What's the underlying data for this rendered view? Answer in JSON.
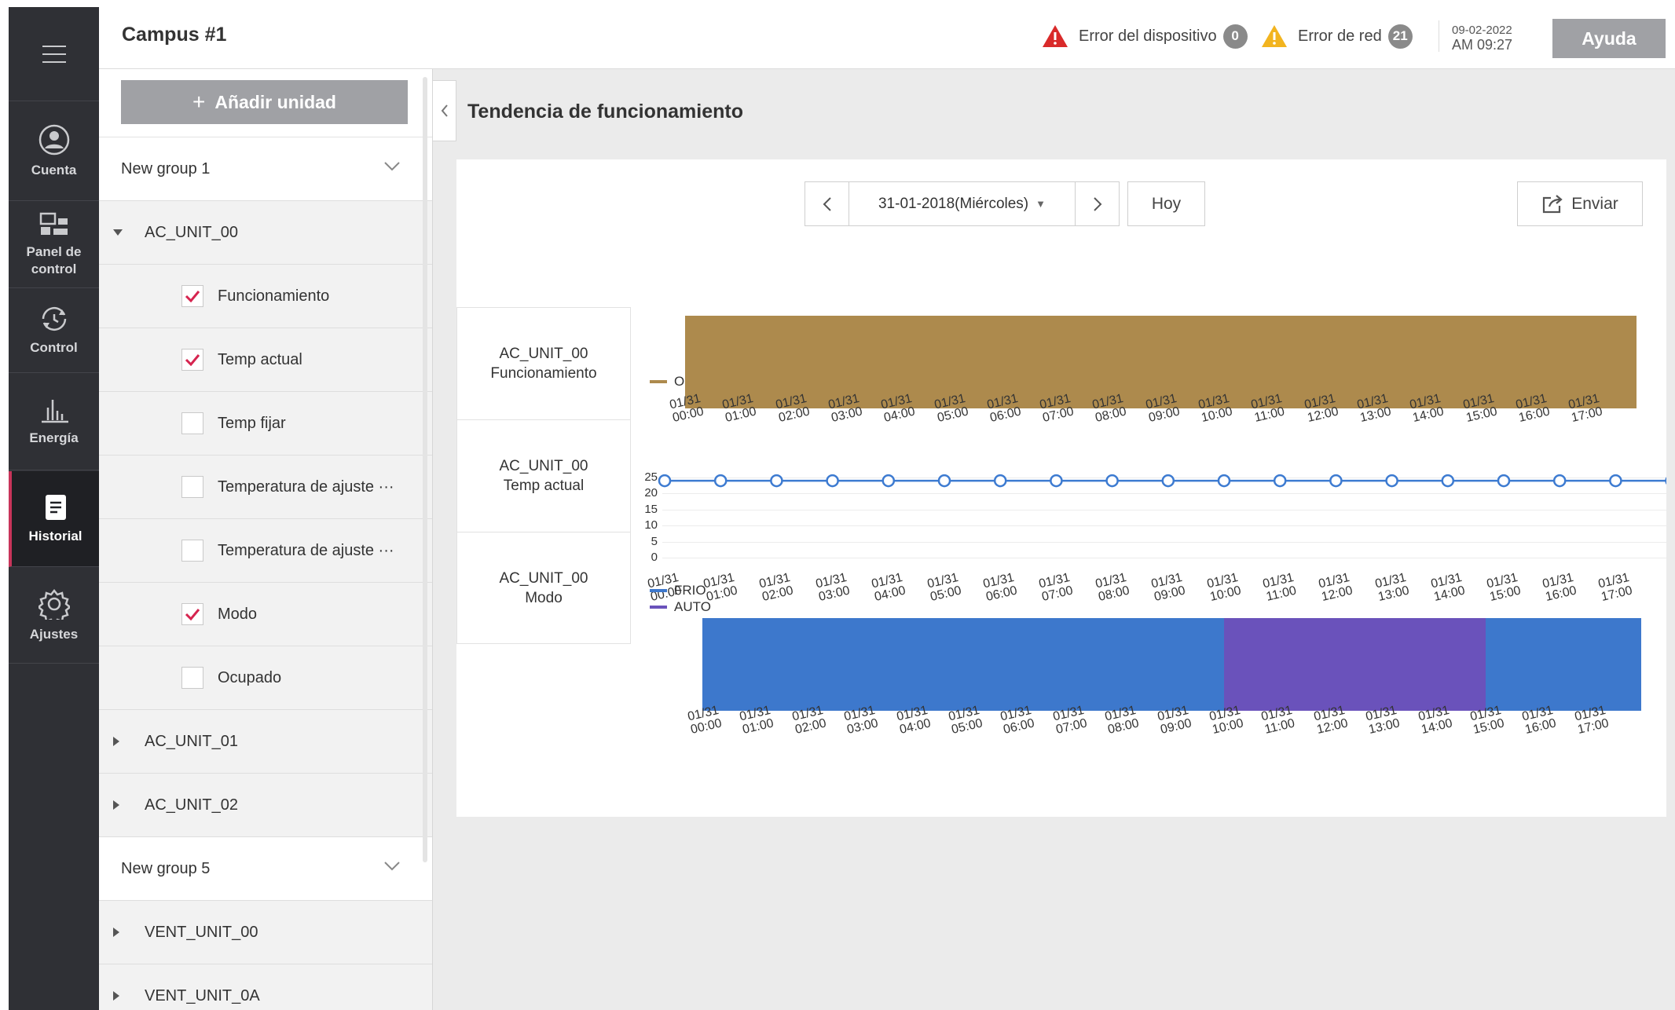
{
  "nav": {
    "menu_icon": "hamburger-icon",
    "items": [
      {
        "label": "Cuenta",
        "icon": "user-circle-icon"
      },
      {
        "label": "Panel de\ncontrol",
        "label_l1": "Panel de",
        "label_l2": "control",
        "icon": "dashboard-icon"
      },
      {
        "label": "Control",
        "icon": "control-icon"
      },
      {
        "label": "Energía",
        "icon": "bar-chart-icon"
      },
      {
        "label": "Historial",
        "icon": "history-icon",
        "active": true
      },
      {
        "label": "Ajustes",
        "icon": "gear-icon"
      }
    ]
  },
  "header": {
    "title": "Campus #1",
    "device_error_label": "Error del dispositivo",
    "device_error_count": "0",
    "network_error_label": "Error de red",
    "network_error_count": "21",
    "date": "09-02-2022",
    "time": "AM 09:27",
    "help_label": "Ayuda",
    "colors": {
      "device_error": "#d92a2a",
      "network_error": "#f2b41f"
    }
  },
  "sidebar": {
    "add_unit_label": "Añadir unidad",
    "groups": [
      {
        "name": "New group 1",
        "units": [
          {
            "name": "AC_UNIT_00",
            "expanded": true,
            "attributes": [
              {
                "label": "Funcionamiento",
                "checked": true
              },
              {
                "label": "Temp actual",
                "checked": true
              },
              {
                "label": "Temp fijar",
                "checked": false
              },
              {
                "label": "Temperatura de ajuste ···",
                "checked": false
              },
              {
                "label": "Temperatura de ajuste ···",
                "checked": false
              },
              {
                "label": "Modo",
                "checked": true
              },
              {
                "label": "Ocupado",
                "checked": false
              }
            ]
          },
          {
            "name": "AC_UNIT_01",
            "expanded": false
          },
          {
            "name": "AC_UNIT_02",
            "expanded": false
          }
        ]
      },
      {
        "name": "New group 5",
        "units": [
          {
            "name": "VENT_UNIT_00",
            "expanded": false
          },
          {
            "name": "VENT_UNIT_0A",
            "expanded": false
          }
        ]
      }
    ]
  },
  "main": {
    "title": "Tendencia de funcionamiento",
    "date_label": "31-01-2018(Miércoles)",
    "today_label": "Hoy",
    "send_label": "Enviar",
    "rows": [
      {
        "line1": "AC_UNIT_00",
        "line2": "Funcionamiento"
      },
      {
        "line1": "AC_UNIT_00",
        "line2": "Temp actual"
      },
      {
        "line1": "AC_UNIT_00",
        "line2": "Modo"
      }
    ]
  },
  "chart_data": [
    {
      "type": "area",
      "series": [
        {
          "name": "ON",
          "color": "#ad8a4d",
          "from": "00:00",
          "to": "17:59"
        }
      ],
      "x_ticks": [
        "01/31 00:00",
        "01/31 01:00",
        "01/31 02:00",
        "01/31 03:00",
        "01/31 04:00",
        "01/31 05:00",
        "01/31 06:00",
        "01/31 07:00",
        "01/31 08:00",
        "01/31 09:00",
        "01/31 10:00",
        "01/31 11:00",
        "01/31 12:00",
        "01/31 13:00",
        "01/31 14:00",
        "01/31 15:00",
        "01/31 16:00",
        "01/31 17:00"
      ]
    },
    {
      "type": "line",
      "ylim": [
        0,
        25
      ],
      "y_ticks": [
        "25",
        "20",
        "15",
        "10",
        "5",
        "0"
      ],
      "series": [
        {
          "name": "",
          "color": "#3d7bd1",
          "values": [
            24,
            24,
            24,
            24,
            24,
            24,
            24,
            24,
            24,
            24,
            24,
            24,
            24,
            24,
            24,
            24,
            24,
            24,
            24
          ]
        }
      ],
      "x_ticks": [
        "01/31 00:00",
        "01/31 01:00",
        "01/31 02:00",
        "01/31 03:00",
        "01/31 04:00",
        "01/31 05:00",
        "01/31 06:00",
        "01/31 07:00",
        "01/31 08:00",
        "01/31 09:00",
        "01/31 10:00",
        "01/31 11:00",
        "01/31 12:00",
        "01/31 13:00",
        "01/31 14:00",
        "01/31 15:00",
        "01/31 16:00",
        "01/31 17:00"
      ]
    },
    {
      "type": "area",
      "series": [
        {
          "name": "FRIO",
          "color": "#3d78cc",
          "segments": [
            [
              "00:00",
              "10:00"
            ],
            [
              "15:00",
              "17:59"
            ]
          ]
        },
        {
          "name": "AUTO",
          "color": "#6a52bb",
          "segments": [
            [
              "10:00",
              "15:00"
            ]
          ]
        }
      ],
      "x_ticks": [
        "01/31 00:00",
        "01/31 01:00",
        "01/31 02:00",
        "01/31 03:00",
        "01/31 04:00",
        "01/31 05:00",
        "01/31 06:00",
        "01/31 07:00",
        "01/31 08:00",
        "01/31 09:00",
        "01/31 10:00",
        "01/31 11:00",
        "01/31 12:00",
        "01/31 13:00",
        "01/31 14:00",
        "01/31 15:00",
        "01/31 16:00",
        "01/31 17:00"
      ]
    }
  ]
}
